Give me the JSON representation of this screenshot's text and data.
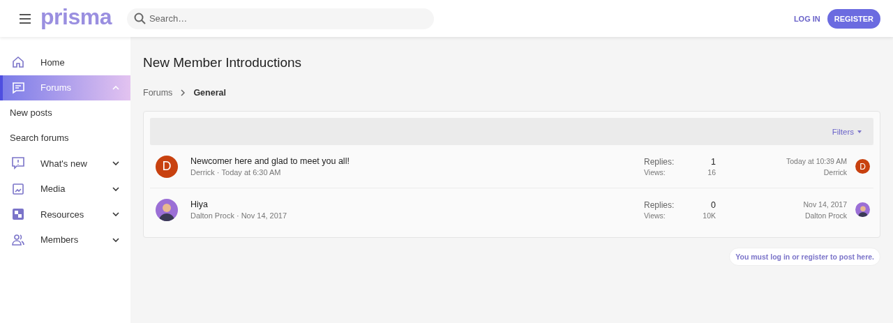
{
  "header": {
    "logo": "prisma",
    "search": {
      "placeholder": "Search…"
    },
    "login": "LOG IN",
    "register": "REGISTER"
  },
  "sidebar": {
    "items": [
      {
        "kind": "nav",
        "label": "Home",
        "selected": false
      },
      {
        "kind": "nav",
        "label": "Forums",
        "selected": true,
        "expanded": true
      },
      {
        "kind": "sub",
        "label": "New posts"
      },
      {
        "kind": "sub",
        "label": "Search forums"
      },
      {
        "kind": "nav",
        "label": "What's new",
        "selected": false,
        "expanded": false
      },
      {
        "kind": "nav",
        "label": "Media",
        "selected": false,
        "expanded": false
      },
      {
        "kind": "nav",
        "label": "Resources",
        "selected": false,
        "expanded": false
      },
      {
        "kind": "nav",
        "label": "Members",
        "selected": false,
        "expanded": false
      }
    ]
  },
  "page": {
    "title": "New Member Introductions",
    "breadcrumbs": [
      "Forums",
      "General"
    ]
  },
  "threads": {
    "filters": "Filters",
    "rows": [
      {
        "avatar": {
          "kind": "letter",
          "letter": "D",
          "color": "#c8410f"
        },
        "title": "Newcomer here and glad to meet you all!",
        "author": "Derrick",
        "separator": "·",
        "date": "Today at 6:30 AM",
        "replies_label": "Replies:",
        "replies": "1",
        "views_label": "Views:",
        "views": "16",
        "last_date": "Today at 10:39 AM",
        "last_user": "Derrick",
        "last_avatar": {
          "kind": "letter",
          "letter": "D",
          "color": "#c8410f"
        }
      },
      {
        "avatar": {
          "kind": "figure",
          "color": "#9b6fd6"
        },
        "title": "Hiya",
        "author": "Dalton Prock",
        "separator": "·",
        "date": "Nov 14, 2017",
        "replies_label": "Replies:",
        "replies": "0",
        "views_label": "Views:",
        "views": "10K",
        "last_date": "Nov 14, 2017",
        "last_user": "Dalton Prock",
        "last_avatar": {
          "kind": "figure",
          "color": "#9b6fd6"
        }
      }
    ]
  },
  "notice": "You must log in or register to post here."
}
